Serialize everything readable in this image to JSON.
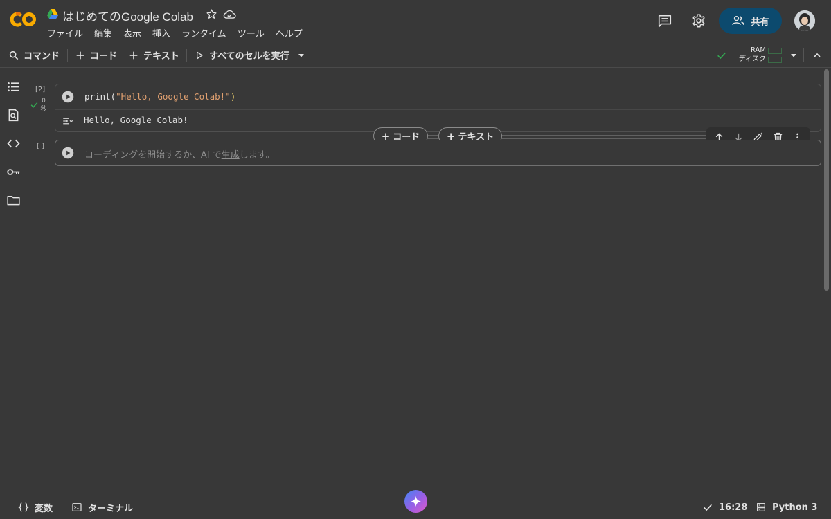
{
  "header": {
    "title": "はじめてのGoogle Colab",
    "menu": [
      "ファイル",
      "編集",
      "表示",
      "挿入",
      "ランタイム",
      "ツール",
      "ヘルプ"
    ],
    "share_label": "共有"
  },
  "toolbar": {
    "command_label": "コマンド",
    "add_code_label": "コード",
    "add_text_label": "テキスト",
    "run_all_label": "すべてのセルを実行",
    "ram_label": "RAM",
    "disk_label": "ディスク"
  },
  "cells": [
    {
      "exec_count": "[2]",
      "exec_time": "0\n秒",
      "code_fn": "print(",
      "code_str": "\"Hello, Google Colab!\"",
      "code_close": ")",
      "output": "Hello, Google Colab!"
    },
    {
      "exec_count": "[ ]",
      "placeholder_before": "コーディングを開始するか、AI で",
      "placeholder_link": "生成",
      "placeholder_after": "します。"
    }
  ],
  "insert": {
    "code_label": "コード",
    "text_label": "テキスト"
  },
  "statusbar": {
    "variables_label": "変数",
    "terminal_label": "ターミナル",
    "time": "16:28",
    "runtime": "Python 3"
  },
  "colors": {
    "background": "#383838",
    "share_button": "#0c4a6e",
    "logo_orange": "#f9ab00",
    "success_green": "#34a853"
  },
  "icons": {
    "rail": [
      "toc-icon",
      "find-icon",
      "code-snippets-icon",
      "secrets-key-icon",
      "files-folder-icon"
    ]
  }
}
